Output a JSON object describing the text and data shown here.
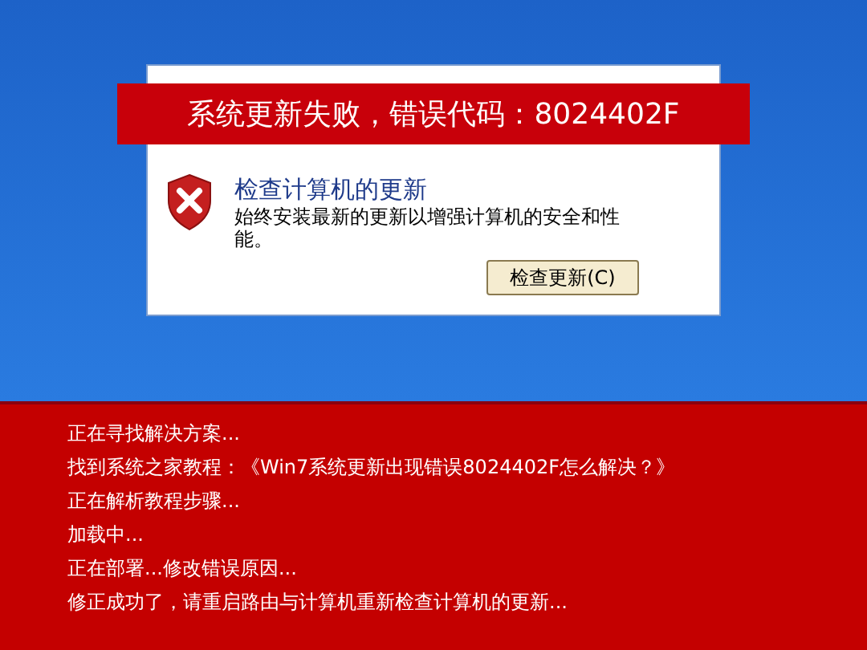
{
  "banner": {
    "title": "系统更新失败，错误代码：8024402F"
  },
  "dialog": {
    "heading": "检查计算机的更新",
    "description": "始终安装最新的更新以增强计算机的安全和性能。",
    "button": "检查更新(C)"
  },
  "log": [
    "正在寻找解决方案...",
    "找到系统之家教程：《Win7系统更新出现错误8024402F怎么解决？》",
    "正在解析教程步骤...",
    "加载中...",
    "正在部署...修改错误原因...",
    "修正成功了，请重启路由与计算机重新检查计算机的更新..."
  ]
}
